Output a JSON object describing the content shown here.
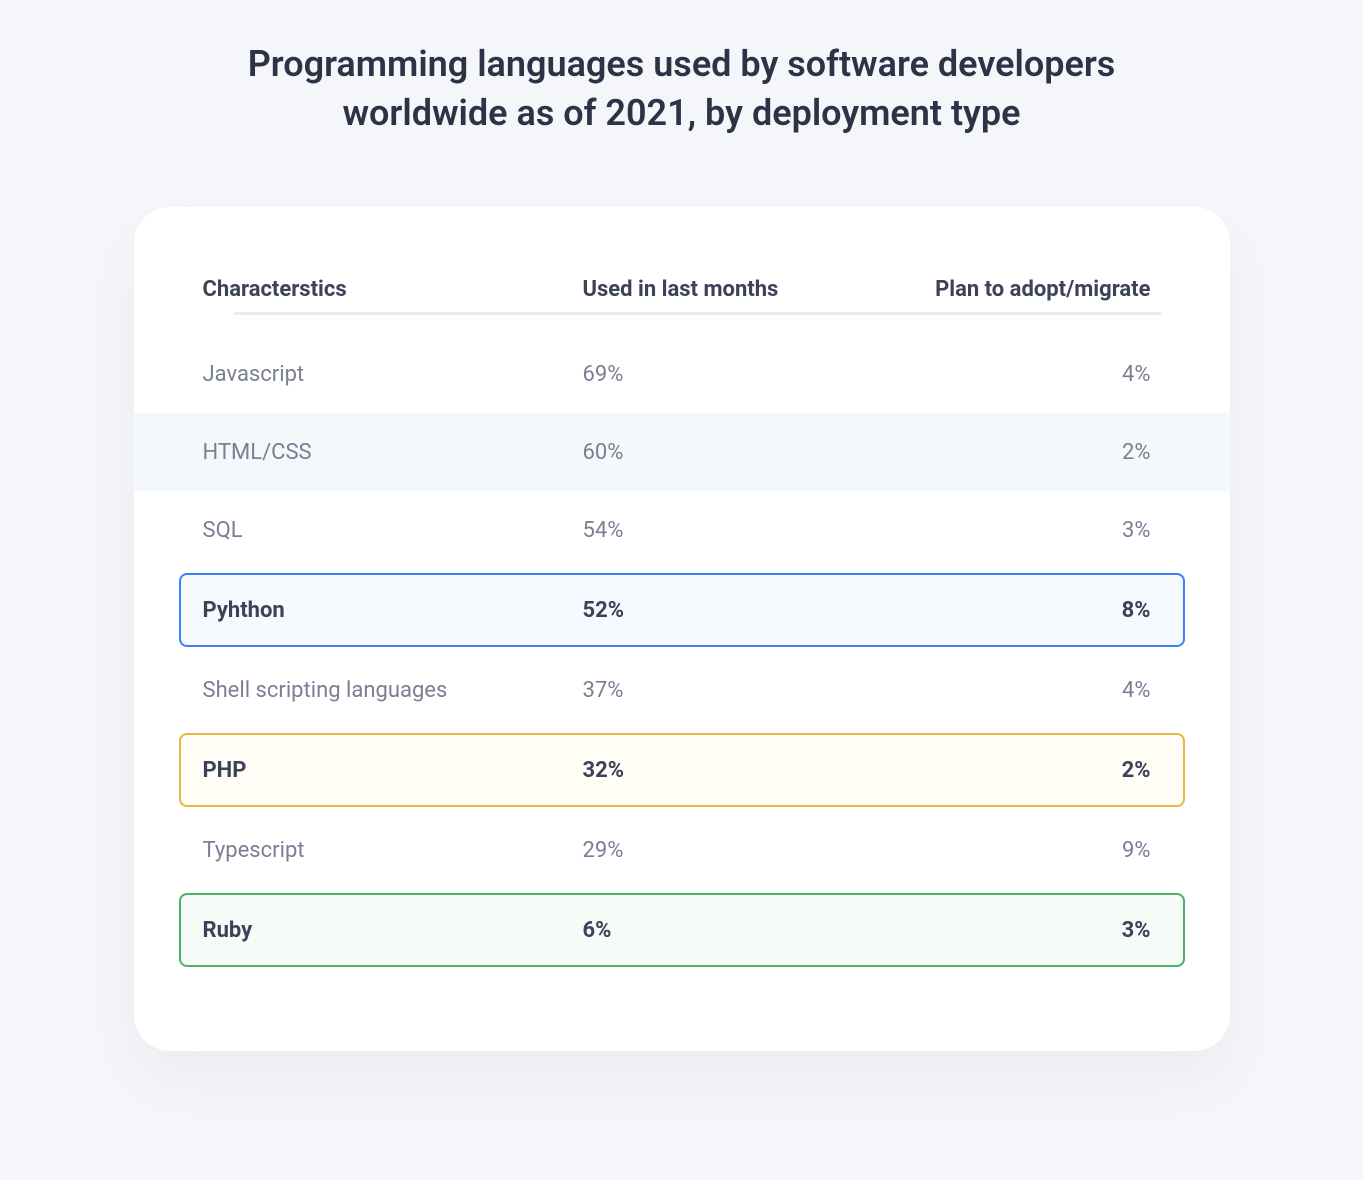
{
  "title": "Programming languages used by software developers worldwide as of 2021, by deployment type",
  "headers": {
    "characteristics": "Characterstics",
    "used": "Used in last months",
    "plan": "Plan to adopt/migrate"
  },
  "rows": [
    {
      "name": "Javascript",
      "used": "69%",
      "plan": "4%",
      "alt": false,
      "highlight": null
    },
    {
      "name": "HTML/CSS",
      "used": "60%",
      "plan": "2%",
      "alt": true,
      "highlight": null
    },
    {
      "name": "SQL",
      "used": "54%",
      "plan": "3%",
      "alt": false,
      "highlight": null
    },
    {
      "name": "Pyhthon",
      "used": "52%",
      "plan": "8%",
      "alt": false,
      "highlight": "blue"
    },
    {
      "name": "Shell scripting languages",
      "used": "37%",
      "plan": "4%",
      "alt": false,
      "highlight": null
    },
    {
      "name": "PHP",
      "used": "32%",
      "plan": "2%",
      "alt": false,
      "highlight": "yellow"
    },
    {
      "name": "Typescript",
      "used": "29%",
      "plan": "9%",
      "alt": false,
      "highlight": null
    },
    {
      "name": "Ruby",
      "used": "6%",
      "plan": "3%",
      "alt": false,
      "highlight": "green"
    }
  ],
  "chart_data": {
    "type": "table",
    "title": "Programming languages used by software developers worldwide as of 2021, by deployment type",
    "columns": [
      "Characterstics",
      "Used in last months",
      "Plan to adopt/migrate"
    ],
    "categories": [
      "Javascript",
      "HTML/CSS",
      "SQL",
      "Pyhthon",
      "Shell scripting languages",
      "PHP",
      "Typescript",
      "Ruby"
    ],
    "series": [
      {
        "name": "Used in last months",
        "values": [
          69,
          60,
          54,
          52,
          37,
          32,
          29,
          6
        ]
      },
      {
        "name": "Plan to adopt/migrate",
        "values": [
          4,
          2,
          3,
          8,
          4,
          2,
          9,
          3
        ]
      }
    ],
    "highlights": {
      "Pyhthon": "blue",
      "PHP": "yellow",
      "Ruby": "green"
    }
  }
}
